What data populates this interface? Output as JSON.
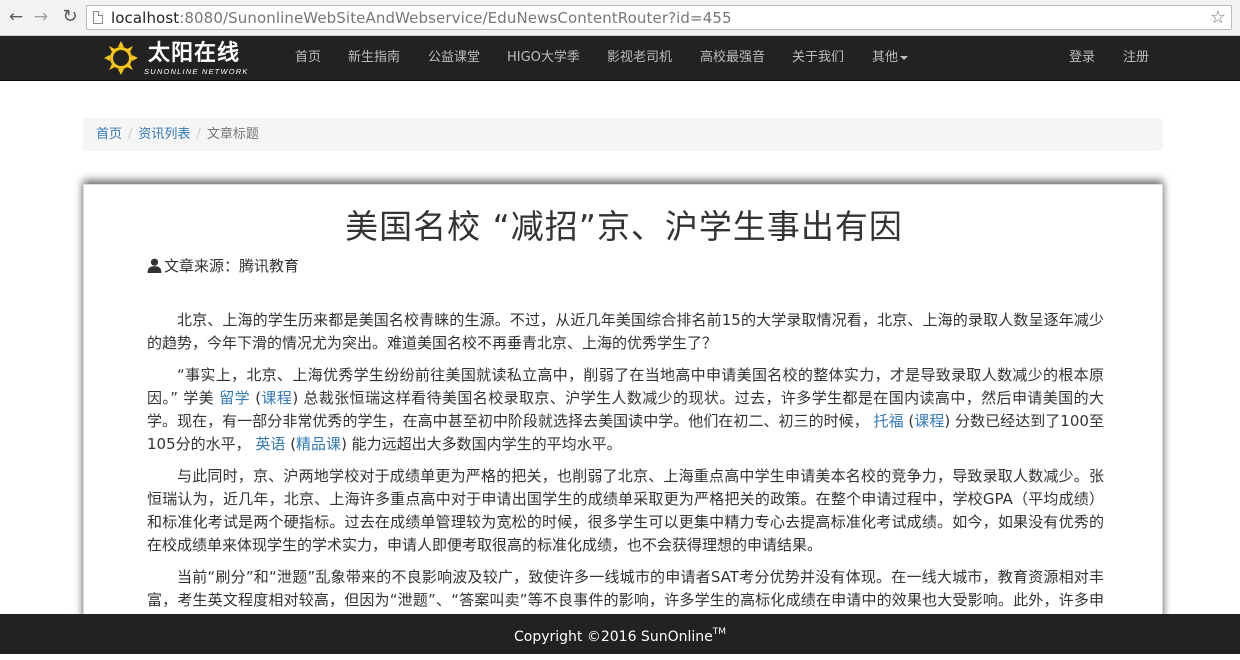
{
  "browser": {
    "url_host": "localhost",
    "url_rest": ":8080/SunonlineWebSiteAndWebservice/EduNewsContentRouter?id=455",
    "back_icon": "arrow-left-icon",
    "forward_icon": "arrow-right-icon",
    "reload_icon": "reload-icon",
    "bookmark_icon": "star-icon"
  },
  "site": {
    "logo_title": "太阳在线",
    "logo_subtitle": "SUNONLINE NETWORK",
    "nav": [
      "首页",
      "新生指南",
      "公益课堂",
      "HIGO大学季",
      "影视老司机",
      "高校最强音",
      "关于我们",
      "其他"
    ],
    "login": "登录",
    "register": "注册"
  },
  "breadcrumb": {
    "home": "首页",
    "list": "资讯列表",
    "current": "文章标题"
  },
  "article": {
    "title": "美国名校 “减招”京、沪学生事出有因",
    "source": "文章来源：腾讯教育",
    "p1": "北京、上海的学生历来都是美国名校青睐的生源。不过，从近几年美国综合排名前15的大学录取情况看，北京、上海的录取人数呈逐年减少的趋势，今年下滑的情况尤为突出。难道美国名校不再垂青北京、上海的优秀学生了？",
    "p2_a": "“事实上，北京、上海优秀学生纷纷前往美国就读私立高中，削弱了在当地高中申请美国名校的整体实力，才是导致录取人数减少的根本原因。” 学美 ",
    "p2_link1": "留学",
    "p2_b": " (",
    "p2_link2": "课程",
    "p2_c": ") 总裁张恒瑞这样看待美国名校录取京、沪学生人数减少的现状。过去，许多学生都是在国内读高中，然后申请美国的大学。现在，有一部分非常优秀的学生，在高中甚至初中阶段就选择去美国读中学。他们在初二、初三的时候， ",
    "p2_link3": "托福",
    "p2_d": " (",
    "p2_link4": "课程",
    "p2_e": ") 分数已经达到了100至105分的水平， ",
    "p2_link5": "英语",
    "p2_f": " (",
    "p2_link6": "精品课",
    "p2_g": ") 能力远超出大多数国内学生的平均水平。",
    "p3": "与此同时，京、沪两地学校对于成绩单更为严格的把关，也削弱了北京、上海重点高中学生申请美本名校的竞争力，导致录取人数减少。张恒瑞认为，近几年，北京、上海许多重点高中对于申请出国学生的成绩单采取更为严格把关的政策。在整个申请过程中，学校GPA（平均成绩）和标准化考试是两个硬指标。过去在成绩单管理较为宽松的时候，很多学生可以更集中精力专心去提高标准化考试成绩。如今，如果没有优秀的在校成绩单来体现学生的学术实力，申请人即便考取很高的标准化成绩，也不会获得理想的申请结果。",
    "p4": "当前“刷分”和“泄题”乱象带来的不良影响波及较广，致使许多一线城市的申请者SAT考分优势并没有体现。在一线大城市，教育资源相对丰富，考生英文程度相对较高，但因为“泄题”、“答案叫卖”等不良事件的影响，许多学生的高标化成绩在申请中的效果也大受影响。此外，许多申请者因担心标化高分不足以录取名校，花费大量时间参加“不靠谱”的活动，挤占考试准备时间，影响考分成绩。"
  },
  "footer": {
    "text": "Copyright ©2016 SunOnline",
    "tm": "TM"
  }
}
